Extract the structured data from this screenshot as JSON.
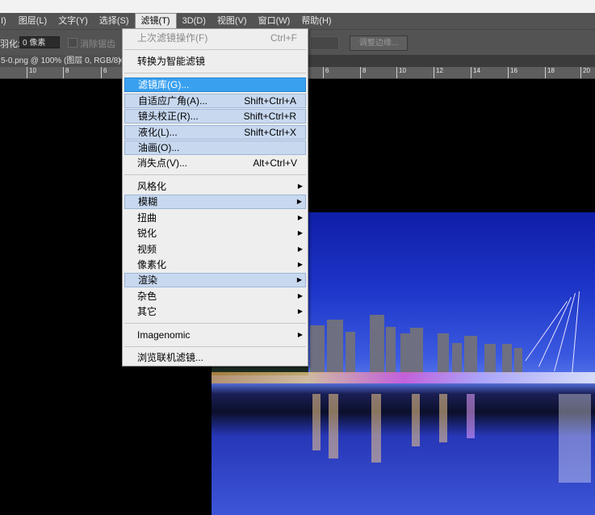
{
  "menubar": {
    "items": [
      "I)",
      "图层(L)",
      "文字(Y)",
      "选择(S)",
      "滤镜(T)",
      "3D(D)",
      "视图(V)",
      "窗口(W)",
      "帮助(H)"
    ],
    "active_index": 4
  },
  "options": {
    "feather_label": "羽化:",
    "feather_value": "0 像素",
    "antialias_label": "消除锯齿",
    "refine_edge": "调整边缘..."
  },
  "document": {
    "tab_title": "5-0.png @ 100% (图层 0, RGB/8)",
    "close": "×"
  },
  "ruler": {
    "labels": [
      "10",
      "8",
      "6",
      "6",
      "8",
      "10",
      "12",
      "14",
      "16",
      "18",
      "20"
    ]
  },
  "filter_menu": {
    "items": [
      {
        "label": "上次滤镜操作(F)",
        "shortcut": "Ctrl+F",
        "state": "disabled"
      },
      {
        "label": "转换为智能滤镜",
        "shortcut": "",
        "state": "normal"
      },
      {
        "label": "滤镜库(G)...",
        "shortcut": "",
        "state": "selected"
      },
      {
        "label": "自适应广角(A)...",
        "shortcut": "Shift+Ctrl+A",
        "state": "highlighted"
      },
      {
        "label": "镜头校正(R)...",
        "shortcut": "Shift+Ctrl+R",
        "state": "highlighted"
      },
      {
        "label": "液化(L)...",
        "shortcut": "Shift+Ctrl+X",
        "state": "highlighted"
      },
      {
        "label": "油画(O)...",
        "shortcut": "",
        "state": "highlighted"
      },
      {
        "label": "消失点(V)...",
        "shortcut": "Alt+Ctrl+V",
        "state": "normal"
      },
      {
        "label": "风格化",
        "submenu": true,
        "state": "normal"
      },
      {
        "label": "模糊",
        "submenu": true,
        "state": "highlighted"
      },
      {
        "label": "扭曲",
        "submenu": true,
        "state": "normal"
      },
      {
        "label": "锐化",
        "submenu": true,
        "state": "normal"
      },
      {
        "label": "视频",
        "submenu": true,
        "state": "normal"
      },
      {
        "label": "像素化",
        "submenu": true,
        "state": "normal"
      },
      {
        "label": "渲染",
        "submenu": true,
        "state": "highlighted"
      },
      {
        "label": "杂色",
        "submenu": true,
        "state": "normal"
      },
      {
        "label": "其它",
        "submenu": true,
        "state": "normal"
      },
      {
        "label": "Imagenomic",
        "submenu": true,
        "state": "normal"
      },
      {
        "label": "浏览联机滤镜...",
        "shortcut": "",
        "state": "normal"
      }
    ],
    "submenu_arrow": "▶"
  }
}
